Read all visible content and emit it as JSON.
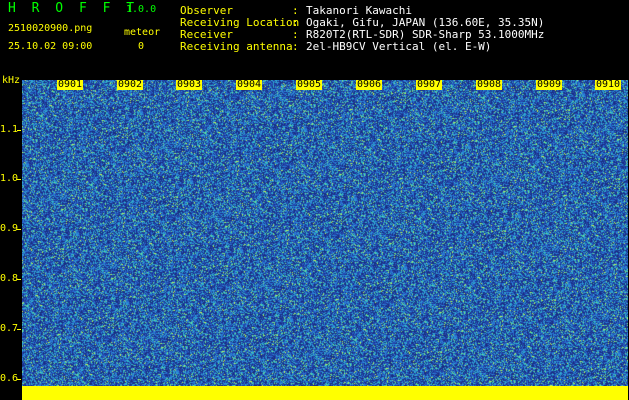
{
  "header": {
    "logo": "H R O F F T",
    "version": "1.0.0",
    "filename": "2510020900.png",
    "datetime": "25.10.02 09:00",
    "meteor_label": "meteor",
    "meteor_count": "0"
  },
  "info": [
    {
      "key": "Observer",
      "value": "Takanori Kawachi"
    },
    {
      "key": "Receiving Location",
      "value": "Ogaki, Gifu, JAPAN (136.60E, 35.35N)"
    },
    {
      "key": "Receiver",
      "value": "R820T2(RTL-SDR) SDR-Sharp 53.1000MHz"
    },
    {
      "key": "Receiving antenna",
      "value": "2el-HB9CV Vertical (el. E-W)"
    }
  ],
  "axis": {
    "unit": "kHz",
    "y_ticks": [
      "1.1",
      "1.0",
      "0.9",
      "0.8",
      "0.7",
      "0.6"
    ],
    "x_ticks": [
      "0901",
      "0902",
      "0903",
      "0904",
      "0905",
      "0906",
      "0907",
      "0908",
      "0909",
      "0910"
    ]
  },
  "colors": {
    "background": "#000000",
    "label": "#ffff00",
    "logo": "#00ff00",
    "spectrum_low": "#1f3a8a",
    "spectrum_mid": "#2a7fd4",
    "spectrum_high": "#30c8c0",
    "spectrum_peak": "#a8ff40"
  }
}
